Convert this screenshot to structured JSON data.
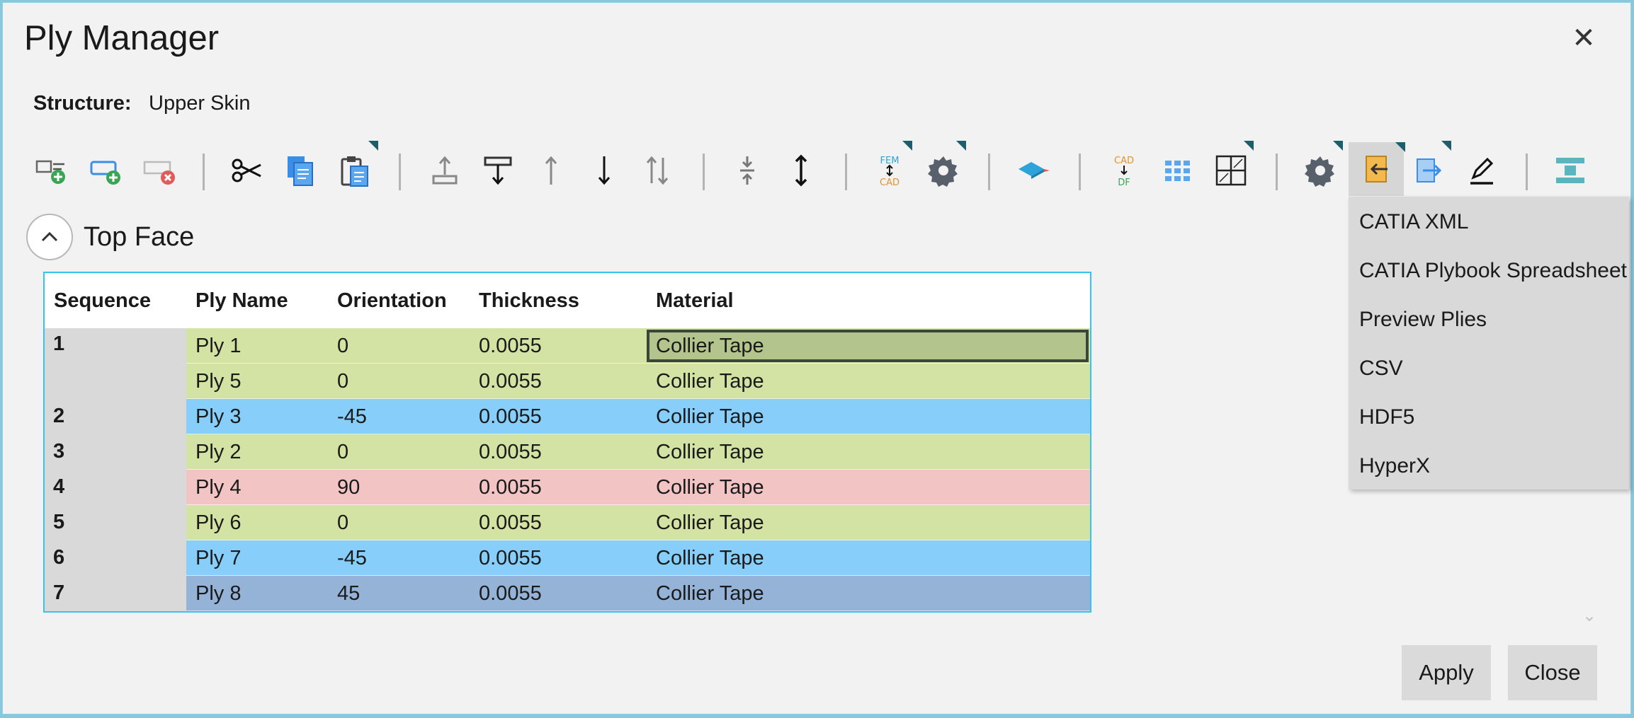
{
  "window": {
    "title": "Ply Manager",
    "close_glyph": "✕"
  },
  "structure": {
    "label": "Structure:",
    "value": "Upper Skin"
  },
  "section": {
    "title": "Top Face"
  },
  "table": {
    "headers": [
      "Sequence",
      "Ply Name",
      "Orientation",
      "Thickness",
      "Material"
    ],
    "sequences": [
      "1",
      "2",
      "3",
      "4",
      "5",
      "6",
      "7"
    ],
    "rows": [
      {
        "ply": "Ply 1",
        "orientation": "0",
        "thickness": "0.0055",
        "material": "Collier Tape",
        "color": "#d3e3a3",
        "selected": true
      },
      {
        "ply": "Ply 5",
        "orientation": "0",
        "thickness": "0.0055",
        "material": "Collier Tape",
        "color": "#d3e3a3"
      },
      {
        "ply": "Ply 3",
        "orientation": "-45",
        "thickness": "0.0055",
        "material": "Collier Tape",
        "color": "#87cefa"
      },
      {
        "ply": "Ply 2",
        "orientation": "0",
        "thickness": "0.0055",
        "material": "Collier Tape",
        "color": "#d3e3a3"
      },
      {
        "ply": "Ply 4",
        "orientation": "90",
        "thickness": "0.0055",
        "material": "Collier Tape",
        "color": "#f2c4c4"
      },
      {
        "ply": "Ply 6",
        "orientation": "0",
        "thickness": "0.0055",
        "material": "Collier Tape",
        "color": "#d3e3a3"
      },
      {
        "ply": "Ply 7",
        "orientation": "-45",
        "thickness": "0.0055",
        "material": "Collier Tape",
        "color": "#87cefa"
      },
      {
        "ply": "Ply 8",
        "orientation": "45",
        "thickness": "0.0055",
        "material": "Collier Tape",
        "color": "#95b3d7"
      }
    ]
  },
  "toolbar": {
    "fem_cad_top": "FEM",
    "fem_cad_bottom": "CAD",
    "cad_df_top": "CAD",
    "cad_df_bottom": "DF",
    "icons": [
      "add-ply-icon",
      "add-group-icon",
      "remove-icon",
      "cut-icon",
      "copy-icon",
      "paste-icon",
      "move-to-top-icon",
      "move-to-bottom-icon",
      "move-up-icon",
      "move-down-icon",
      "swap-icon",
      "collapse-icon",
      "expand-icon",
      "fem-cad-icon",
      "settings-icon",
      "layer-icon",
      "cad-df-icon",
      "grid-icon",
      "table-icon",
      "gear-icon",
      "import-icon",
      "export-icon",
      "edit-icon",
      "stack-icon"
    ]
  },
  "import_menu": {
    "items": [
      "CATIA XML",
      "CATIA Plybook Spreadsheet",
      "Preview Plies",
      "CSV",
      "HDF5",
      "HyperX"
    ]
  },
  "buttons": {
    "apply": "Apply",
    "close": "Close"
  },
  "colors": {
    "grid_border": "#35c5ec",
    "zero_deg": "#d3e3a3",
    "minus45": "#87cefa",
    "ninety": "#f2c4c4",
    "plus45": "#95b3d7",
    "selected_cell": "#b3c48c"
  }
}
